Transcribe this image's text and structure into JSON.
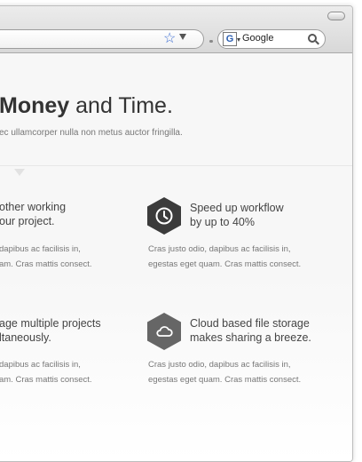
{
  "browser": {
    "search_value": "Google",
    "search_engine_icon": "G"
  },
  "hero": {
    "headline_bold": "Money",
    "headline_rest": " and Time.",
    "subline": "ec ullamcorper nulla non metus auctor fringilla."
  },
  "features": [
    {
      "title_1": "other working",
      "title_2": "our project.",
      "desc_1": "dapibus ac facilisis in,",
      "desc_2": "am. Cras mattis consect."
    },
    {
      "title_1": "Speed up workflow",
      "title_2": "by up to 40%",
      "desc_1": "Cras justo odio, dapibus ac facilisis in,",
      "desc_2": "egestas eget quam. Cras mattis consect.",
      "icon": "clock-icon"
    },
    {
      "title_1": "age multiple projects",
      "title_2": "ltaneously.",
      "desc_1": "dapibus ac facilisis in,",
      "desc_2": "am. Cras mattis consect."
    },
    {
      "title_1": "Cloud based file storage",
      "title_2": "makes sharing a breeze.",
      "desc_1": "Cras justo odio, dapibus ac facilisis in,",
      "desc_2": "egestas eget quam. Cras mattis consect.",
      "icon": "cloud-icon"
    }
  ]
}
